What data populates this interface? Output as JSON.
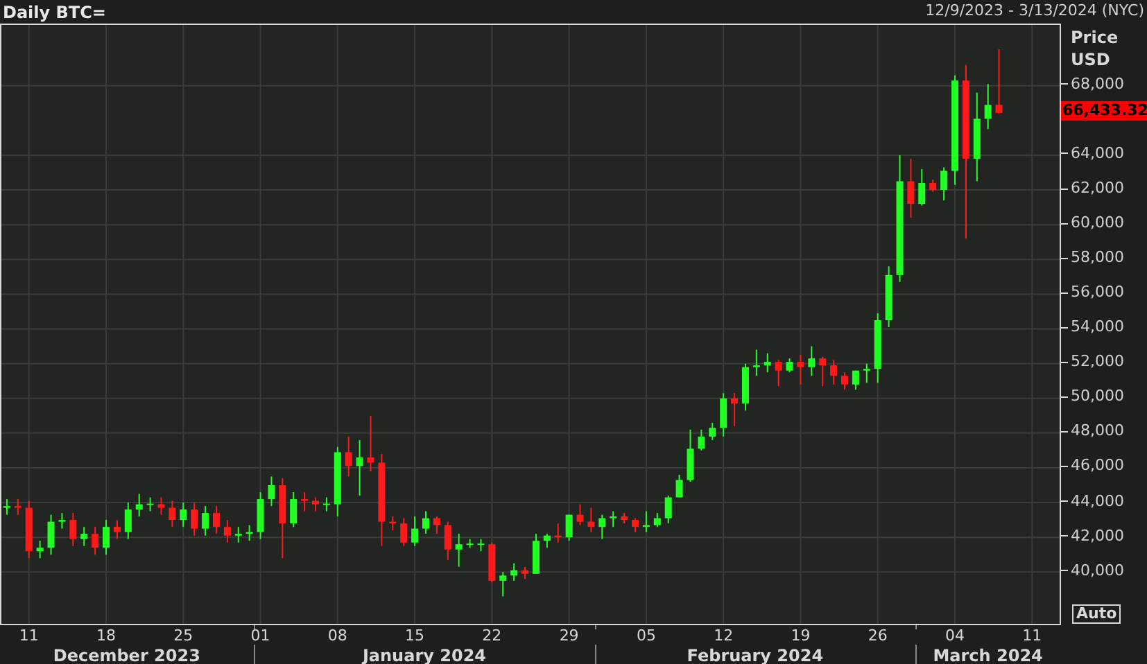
{
  "header": {
    "title": "Daily BTC=",
    "range": "12/9/2023 - 3/13/2024 (NYC)"
  },
  "chart": {
    "axis_title": [
      "Price",
      "USD"
    ],
    "last_price": "66,433.32",
    "auto_button": "Auto",
    "months": [
      "December 2023",
      "January 2024",
      "February 2024",
      "March 2024"
    ],
    "chart_data": {
      "type": "candlestick",
      "x": [
        "2023-12-09",
        "2023-12-10",
        "2023-12-11",
        "2023-12-12",
        "2023-12-13",
        "2023-12-14",
        "2023-12-15",
        "2023-12-16",
        "2023-12-17",
        "2023-12-18",
        "2023-12-19",
        "2023-12-20",
        "2023-12-21",
        "2023-12-22",
        "2023-12-23",
        "2023-12-24",
        "2023-12-25",
        "2023-12-26",
        "2023-12-27",
        "2023-12-28",
        "2023-12-29",
        "2023-12-30",
        "2023-12-31",
        "2024-01-01",
        "2024-01-02",
        "2024-01-03",
        "2024-01-04",
        "2024-01-05",
        "2024-01-06",
        "2024-01-07",
        "2024-01-08",
        "2024-01-09",
        "2024-01-10",
        "2024-01-11",
        "2024-01-12",
        "2024-01-13",
        "2024-01-14",
        "2024-01-15",
        "2024-01-16",
        "2024-01-17",
        "2024-01-18",
        "2024-01-19",
        "2024-01-20",
        "2024-01-21",
        "2024-01-22",
        "2024-01-23",
        "2024-01-24",
        "2024-01-25",
        "2024-01-26",
        "2024-01-27",
        "2024-01-28",
        "2024-01-29",
        "2024-01-30",
        "2024-01-31",
        "2024-02-01",
        "2024-02-02",
        "2024-02-03",
        "2024-02-04",
        "2024-02-05",
        "2024-02-06",
        "2024-02-07",
        "2024-02-08",
        "2024-02-09",
        "2024-02-10",
        "2024-02-11",
        "2024-02-12",
        "2024-02-13",
        "2024-02-14",
        "2024-02-15",
        "2024-02-16",
        "2024-02-17",
        "2024-02-18",
        "2024-02-19",
        "2024-02-20",
        "2024-02-21",
        "2024-02-22",
        "2024-02-23",
        "2024-02-24",
        "2024-02-25",
        "2024-02-26",
        "2024-02-27",
        "2024-02-28",
        "2024-02-29",
        "2024-03-01",
        "2024-03-02",
        "2024-03-03",
        "2024-03-04",
        "2024-03-05",
        "2024-03-06",
        "2024-03-07",
        "2024-03-08"
      ],
      "ohlc": [
        [
          43700,
          44200,
          43300,
          43800
        ],
        [
          43800,
          44200,
          43300,
          43700
        ],
        [
          43700,
          44100,
          40800,
          41200
        ],
        [
          41200,
          41800,
          40800,
          41400
        ],
        [
          41400,
          43300,
          41000,
          42900
        ],
        [
          42900,
          43400,
          42500,
          43000
        ],
        [
          43000,
          43400,
          41500,
          41900
        ],
        [
          41900,
          42600,
          41500,
          42200
        ],
        [
          42200,
          42600,
          41000,
          41400
        ],
        [
          41400,
          43000,
          41000,
          42600
        ],
        [
          42600,
          43000,
          41900,
          42300
        ],
        [
          42300,
          44000,
          41900,
          43600
        ],
        [
          43600,
          44500,
          43200,
          43900
        ],
        [
          43900,
          44300,
          43500,
          43900
        ],
        [
          43900,
          44300,
          43300,
          43700
        ],
        [
          43700,
          44100,
          42600,
          43000
        ],
        [
          43000,
          44000,
          42600,
          43600
        ],
        [
          43600,
          44000,
          42100,
          42500
        ],
        [
          42500,
          43800,
          42100,
          43400
        ],
        [
          43400,
          43800,
          42200,
          42600
        ],
        [
          42600,
          43000,
          41700,
          42100
        ],
        [
          42100,
          42600,
          41700,
          42200
        ],
        [
          42200,
          42700,
          41800,
          42300
        ],
        [
          42300,
          44600,
          41900,
          44200
        ],
        [
          44200,
          45500,
          43800,
          45000
        ],
        [
          45000,
          45400,
          40800,
          42800
        ],
        [
          42800,
          44600,
          42600,
          44200
        ],
        [
          44200,
          44600,
          43500,
          44100
        ],
        [
          44100,
          44300,
          43500,
          43900
        ],
        [
          43900,
          44300,
          43500,
          43900
        ],
        [
          43900,
          47200,
          43200,
          46900
        ],
        [
          46900,
          47800,
          45500,
          46100
        ],
        [
          46100,
          47600,
          44400,
          46600
        ],
        [
          46600,
          49000,
          45800,
          46300
        ],
        [
          46300,
          46800,
          41500,
          42900
        ],
        [
          42900,
          43200,
          42400,
          42800
        ],
        [
          42800,
          43100,
          41500,
          41700
        ],
        [
          41700,
          43200,
          41500,
          42500
        ],
        [
          42500,
          43500,
          42200,
          43100
        ],
        [
          43100,
          43200,
          42200,
          42700
        ],
        [
          42700,
          42900,
          40700,
          41300
        ],
        [
          41300,
          42200,
          40300,
          41600
        ],
        [
          41600,
          41900,
          41400,
          41600
        ],
        [
          41600,
          41900,
          41200,
          41600
        ],
        [
          41600,
          41700,
          39400,
          39500
        ],
        [
          39500,
          40000,
          38600,
          39800
        ],
        [
          39800,
          40500,
          39500,
          40100
        ],
        [
          40100,
          40300,
          39600,
          39900
        ],
        [
          39900,
          42200,
          39900,
          41800
        ],
        [
          41800,
          42200,
          41400,
          42100
        ],
        [
          42100,
          42800,
          41700,
          42000
        ],
        [
          42000,
          43300,
          41800,
          43300
        ],
        [
          43300,
          43900,
          42700,
          42900
        ],
        [
          42900,
          43700,
          42300,
          42600
        ],
        [
          42600,
          43300,
          41900,
          43100
        ],
        [
          43100,
          43500,
          42600,
          43200
        ],
        [
          43200,
          43400,
          42800,
          43000
        ],
        [
          43000,
          43100,
          42300,
          42600
        ],
        [
          42600,
          43500,
          42300,
          42700
        ],
        [
          42700,
          43400,
          42600,
          43100
        ],
        [
          43100,
          44400,
          42800,
          44300
        ],
        [
          44300,
          45600,
          44300,
          45300
        ],
        [
          45300,
          48200,
          45200,
          47100
        ],
        [
          47100,
          48200,
          47000,
          47800
        ],
        [
          47800,
          48600,
          47600,
          48300
        ],
        [
          48300,
          50300,
          47800,
          50000
        ],
        [
          50000,
          50300,
          48400,
          49700
        ],
        [
          49700,
          52000,
          49300,
          51800
        ],
        [
          51800,
          52800,
          51300,
          51900
        ],
        [
          51900,
          52600,
          51500,
          52100
        ],
        [
          52100,
          52200,
          50700,
          51600
        ],
        [
          51600,
          52300,
          51500,
          52100
        ],
        [
          52100,
          52500,
          50800,
          51800
        ],
        [
          51800,
          53000,
          51300,
          52300
        ],
        [
          52300,
          52400,
          50700,
          51900
        ],
        [
          51900,
          52200,
          50800,
          51300
        ],
        [
          51300,
          51500,
          50500,
          50800
        ],
        [
          50800,
          51600,
          50500,
          51600
        ],
        [
          51600,
          52000,
          50900,
          51700
        ],
        [
          51700,
          54900,
          50900,
          54500
        ],
        [
          54500,
          57600,
          54100,
          57100
        ],
        [
          57100,
          64000,
          56700,
          62500
        ],
        [
          62500,
          63800,
          60400,
          61200
        ],
        [
          61200,
          63200,
          61100,
          62400
        ],
        [
          62400,
          62600,
          61900,
          62000
        ],
        [
          62000,
          63300,
          61400,
          63100
        ],
        [
          63100,
          68600,
          62300,
          68300
        ],
        [
          68300,
          69200,
          59200,
          63800
        ],
        [
          63800,
          67600,
          62500,
          66100
        ],
        [
          66100,
          68100,
          65500,
          66900
        ],
        [
          66900,
          70100,
          66400,
          66433.32
        ]
      ],
      "grid": true,
      "xlim": [
        "2023-12-09",
        "2024-03-13"
      ],
      "ylim": [
        37100,
        71500
      ],
      "xticks": [
        {
          "value": "2023-12-11",
          "label": "11"
        },
        {
          "value": "2023-12-18",
          "label": "18"
        },
        {
          "value": "2023-12-25",
          "label": "25"
        },
        {
          "value": "2024-01-01",
          "label": "01"
        },
        {
          "value": "2024-01-08",
          "label": "08"
        },
        {
          "value": "2024-01-15",
          "label": "15"
        },
        {
          "value": "2024-01-22",
          "label": "22"
        },
        {
          "value": "2024-01-29",
          "label": "29"
        },
        {
          "value": "2024-02-05",
          "label": "05"
        },
        {
          "value": "2024-02-12",
          "label": "12"
        },
        {
          "value": "2024-02-19",
          "label": "19"
        },
        {
          "value": "2024-02-26",
          "label": "26"
        },
        {
          "value": "2024-03-04",
          "label": "04"
        },
        {
          "value": "2024-03-11",
          "label": "11"
        }
      ],
      "yticks": [
        {
          "value": 40000,
          "label": "40,000"
        },
        {
          "value": 42000,
          "label": "42,000"
        },
        {
          "value": 44000,
          "label": "44,000"
        },
        {
          "value": 46000,
          "label": "46,000"
        },
        {
          "value": 48000,
          "label": "48,000"
        },
        {
          "value": 50000,
          "label": "50,000"
        },
        {
          "value": 52000,
          "label": "52,000"
        },
        {
          "value": 54000,
          "label": "54,000"
        },
        {
          "value": 56000,
          "label": "56,000"
        },
        {
          "value": 58000,
          "label": "58,000"
        },
        {
          "value": 60000,
          "label": "60,000"
        },
        {
          "value": 62000,
          "label": "62,000"
        },
        {
          "value": 64000,
          "label": "64,000"
        },
        {
          "value": 68000,
          "label": "68,000"
        }
      ]
    }
  }
}
